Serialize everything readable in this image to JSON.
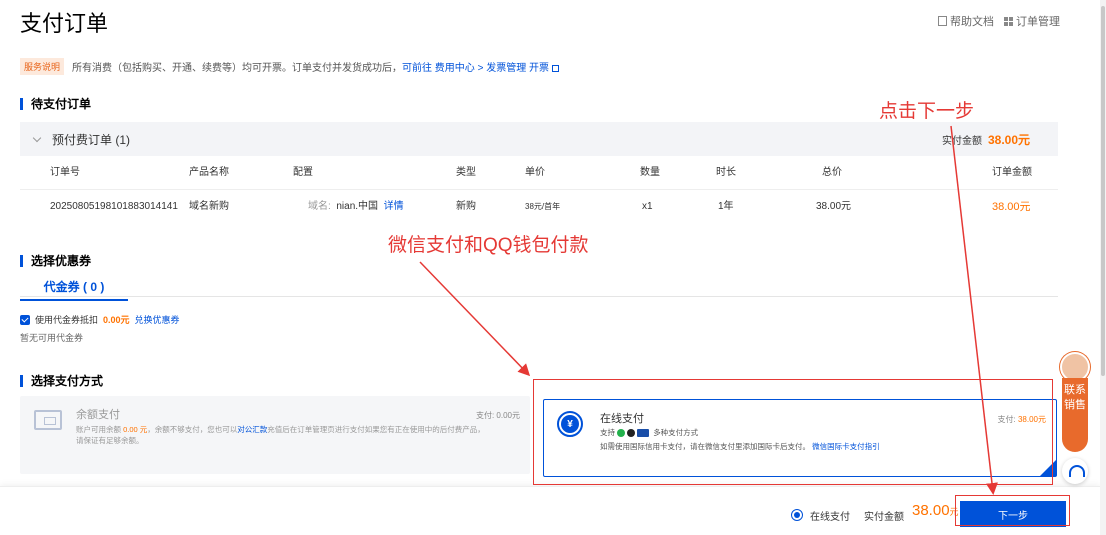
{
  "page": {
    "title": "支付订单"
  },
  "top_links": {
    "help": "帮助文档",
    "orders": "订单管理"
  },
  "notice": {
    "tag": "服务说明",
    "text": "所有消费（包括购买、开通、续费等）均可开票。订单支付并发货成功后，",
    "link": "可前往 费用中心 > 发票管理 开票"
  },
  "sections": {
    "pending": "待支付订单",
    "coupon": "选择优惠券",
    "payment": "选择支付方式"
  },
  "order_group": {
    "title": "预付费订单 (1)",
    "pay_label": "实付金额",
    "pay_amount": "38.00元"
  },
  "table": {
    "headers": [
      "订单号",
      "产品名称",
      "配置",
      "类型",
      "单价",
      "数量",
      "时长",
      "总价",
      "订单金额"
    ],
    "row": {
      "order_no": "20250805198101883014141",
      "product": "域名新购",
      "config_label": "域名:",
      "config_value": "nian.中国",
      "details": "详情",
      "type": "新购",
      "unit_price": "38元/首年",
      "qty": "x1",
      "duration": "1年",
      "total": "38.00元",
      "order_amount": "38.00元"
    }
  },
  "coupon": {
    "tab": "代金券 ( 0 )",
    "use_label": "使用代金券抵扣",
    "use_amount": "0.00元",
    "exchange": "兑换优惠券",
    "none": "暂无可用代金券"
  },
  "payment": {
    "balance": {
      "title": "余额支付",
      "desc_prefix": "账户可用余额",
      "desc_amount": "0.00 元",
      "desc_mid": "，余额不够支付，您也可以",
      "desc_link": "对公汇款",
      "desc_suffix": "充值后在订单管理页进行支付如果您有正在使用中的后付费产品，请保证有足够余额。",
      "price": "支付: 0.00元"
    },
    "online": {
      "title": "在线支付",
      "support_prefix": "支持",
      "support_suffix": "多种支付方式",
      "note": "如需使用国际信用卡支付，请在微信支付里添加国际卡后支付。",
      "note_link": "微信国际卡支付指引",
      "price_label": "支付:",
      "price_value": "38.00元"
    }
  },
  "footer": {
    "method": "在线支付",
    "pay_label": "实付金额",
    "amount": "38.00",
    "unit": "元",
    "next": "下一步"
  },
  "annotations": {
    "next_hint": "点击下一步",
    "pay_hint": "微信支付和QQ钱包付款"
  },
  "sales_widget": {
    "label": "联系销售"
  },
  "colors": {
    "accent": "#0052d9",
    "price": "#ff7200",
    "annotation": "#e53935",
    "sales": "#e86a2c"
  }
}
